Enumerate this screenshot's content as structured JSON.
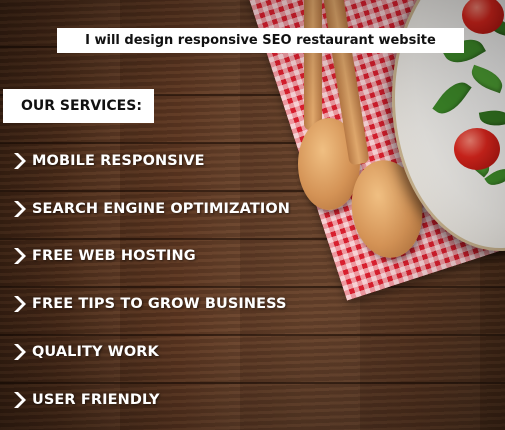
{
  "headline": "I will design responsive SEO restaurant website",
  "services_title": "OUR SERVICES:",
  "services": [
    {
      "label": "MOBILE RESPONSIVE"
    },
    {
      "label": "SEARCH ENGINE OPTIMIZATION"
    },
    {
      "label": "FREE WEB HOSTING"
    },
    {
      "label": "FREE TIPS TO GROW BUSINESS"
    },
    {
      "label": "QUALITY WORK"
    },
    {
      "label": "USER FRIENDLY"
    }
  ],
  "icons": {
    "bullet": "chevron-right-icon"
  },
  "colors": {
    "wood": "#5a3520",
    "text_light": "#ffffff",
    "text_dark": "#111111",
    "box_bg": "#ffffff",
    "tablecloth": "#d81f2e"
  }
}
